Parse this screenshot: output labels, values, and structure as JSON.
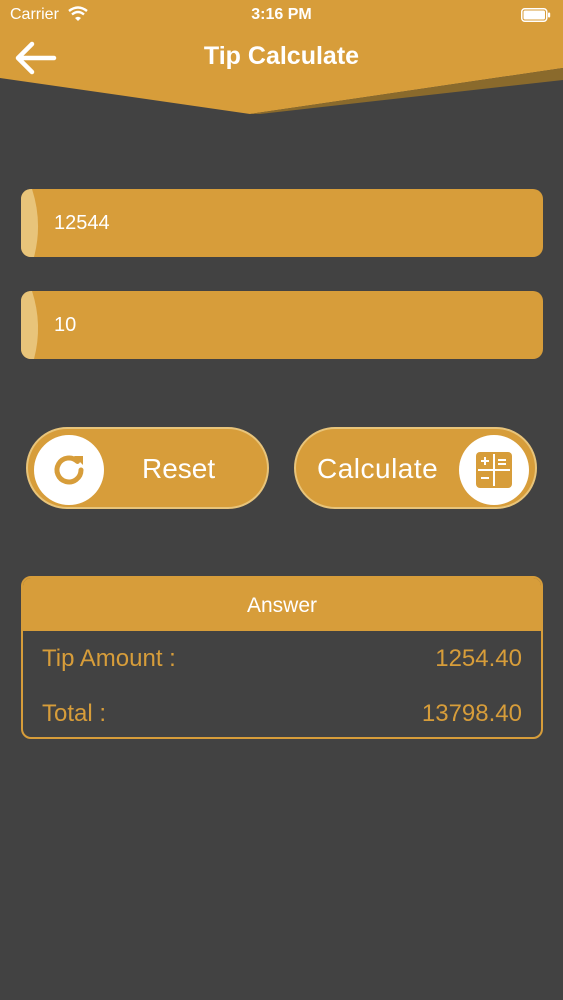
{
  "status_bar": {
    "carrier": "Carrier",
    "time": "3:16 PM"
  },
  "header": {
    "title": "Tip Calculate"
  },
  "inputs": {
    "bill_amount": "12544",
    "tip_percent": "10"
  },
  "buttons": {
    "reset_label": "Reset",
    "calculate_label": "Calculate"
  },
  "answer": {
    "heading": "Answer",
    "tip_label": "Tip Amount :",
    "tip_value": "1254.40",
    "total_label": "Total :",
    "total_value": "13798.40"
  },
  "colors": {
    "accent": "#d79d3a",
    "background": "#424242",
    "accent_light": "#e8c47a"
  }
}
